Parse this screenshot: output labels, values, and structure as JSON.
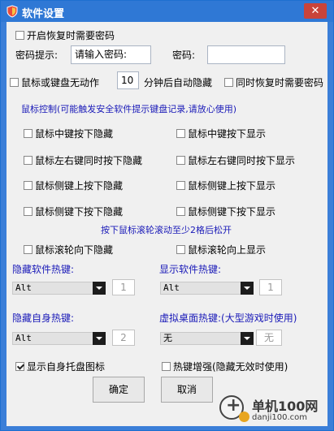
{
  "window": {
    "title": "软件设置",
    "close_glyph": "✕",
    "title_icon": "shield-icon"
  },
  "startup": {
    "require_password_label": "开启恢复时需要密码",
    "require_password_checked": false,
    "password_hint_label": "密码提示:",
    "password_hint_value": "请输入密码:",
    "password_label": "密码:",
    "password_value": ""
  },
  "autohide": {
    "idle_label": "鼠标或键盘无动作",
    "idle_checked": false,
    "minutes_value": "10",
    "minutes_suffix": "分钟后自动隐藏",
    "restore_password_label": "同时恢复时需要密码",
    "restore_password_checked": false
  },
  "mouse_control": {
    "heading": "鼠标控制(可能触发安全软件提示键盘记录,请放心使用)",
    "rows": [
      {
        "hide": "鼠标中键按下隐藏",
        "show": "鼠标中键按下显示"
      },
      {
        "hide": "鼠标左右键同时按下隐藏",
        "show": "鼠标左右键同时按下显示"
      },
      {
        "hide": "鼠标侧键上按下隐藏",
        "show": "鼠标侧键上按下显示"
      },
      {
        "hide": "鼠标侧键下按下隐藏",
        "show": "鼠标侧键下按下显示"
      }
    ],
    "wheel_note": "按下鼠标滚轮滚动至少2格后松开",
    "wheel_hide": "鼠标滚轮向下隐藏",
    "wheel_show": "鼠标滚轮向上显示"
  },
  "hotkeys": {
    "hide_software_label": "隐藏软件热键:",
    "hide_software_mod": "Alt",
    "hide_software_key": "1",
    "show_software_label": "显示软件热键:",
    "show_software_mod": "Alt",
    "show_software_key": "1",
    "hide_self_label": "隐藏自身热键:",
    "hide_self_mod": "Alt",
    "hide_self_key": "2",
    "virtual_desktop_label": "虚拟桌面热键:(大型游戏时使用)",
    "virtual_desktop_mod": "无",
    "virtual_desktop_key": "无"
  },
  "options": {
    "tray_icon_label": "显示自身托盘图标",
    "tray_icon_checked": true,
    "hotkey_boost_label": "热键增强(隐藏无效时使用)",
    "hotkey_boost_checked": false
  },
  "buttons": {
    "ok": "确定",
    "cancel": "取消"
  },
  "watermark": {
    "main": "单机100网",
    "sub": "danji100.com"
  },
  "colors": {
    "titlebar": "#2f78d5",
    "close": "#c9443a",
    "accent_text": "#1a1ab8"
  }
}
